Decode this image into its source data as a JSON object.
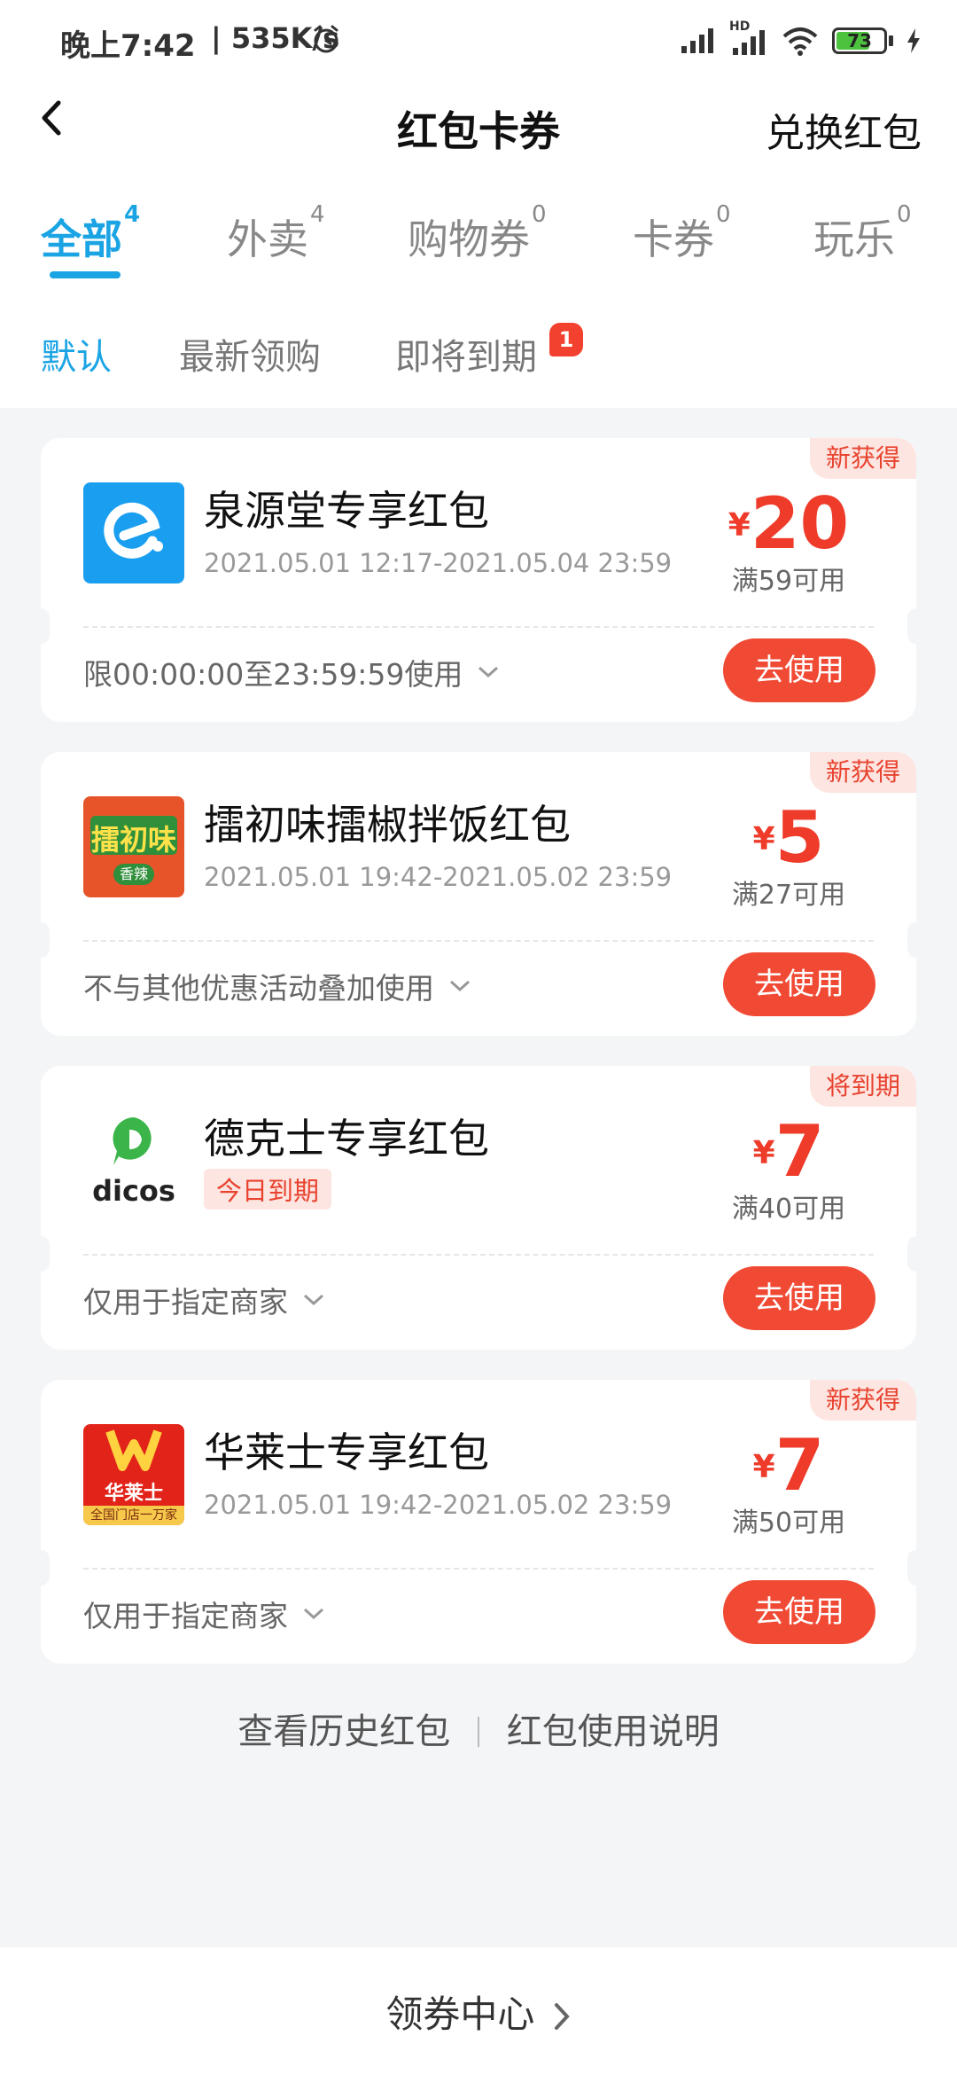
{
  "status": {
    "time": "晚上7:42",
    "speed": "| 535K/s",
    "battery": "73",
    "hd": "HD"
  },
  "header": {
    "title": "红包卡券",
    "exchange": "兑换红包"
  },
  "tabs": [
    {
      "label": "全部",
      "count": "4"
    },
    {
      "label": "外卖",
      "count": "4"
    },
    {
      "label": "购物券",
      "count": "0"
    },
    {
      "label": "卡券",
      "count": "0"
    },
    {
      "label": "玩乐",
      "count": "0"
    }
  ],
  "sort": {
    "default": "默认",
    "latest": "最新领购",
    "expiring": "即将到期",
    "expiring_badge": "1"
  },
  "cards": [
    {
      "tag": "新获得",
      "logo_text": "e",
      "title": "泉源堂专享红包",
      "date": "2021.05.01 12:17-2021.05.04 23:59",
      "currency": "¥",
      "amount": "20",
      "condition": "满59可用",
      "rule": "限00:00:00至23:59:59使用",
      "button": "去使用"
    },
    {
      "tag": "新获得",
      "logo_text": "擂初味",
      "logo_sub": "香辣",
      "title": "擂初味擂椒拌饭红包",
      "date": "2021.05.01 19:42-2021.05.02 23:59",
      "currency": "¥",
      "amount": "5",
      "condition": "满27可用",
      "rule": "不与其他优惠活动叠加使用",
      "button": "去使用"
    },
    {
      "tag": "将到期",
      "logo_text": "dicos",
      "title": "德克士专享红包",
      "expire_tag": "今日到期",
      "currency": "¥",
      "amount": "7",
      "condition": "满40可用",
      "rule": "仅用于指定商家",
      "button": "去使用"
    },
    {
      "tag": "新获得",
      "logo_text": "华莱士",
      "logo_sub": "全国门店一万家",
      "title": "华莱士专享红包",
      "date": "2021.05.01 19:42-2021.05.02 23:59",
      "currency": "¥",
      "amount": "7",
      "condition": "满50可用",
      "rule": "仅用于指定商家",
      "button": "去使用"
    }
  ],
  "footer": {
    "history": "查看历史红包",
    "instructions": "红包使用说明",
    "coupon_center": "领券中心"
  },
  "colors": {
    "accent_blue": "#1ba4e4",
    "red": "#f04a35",
    "tag_bg": "#fde5e1"
  }
}
